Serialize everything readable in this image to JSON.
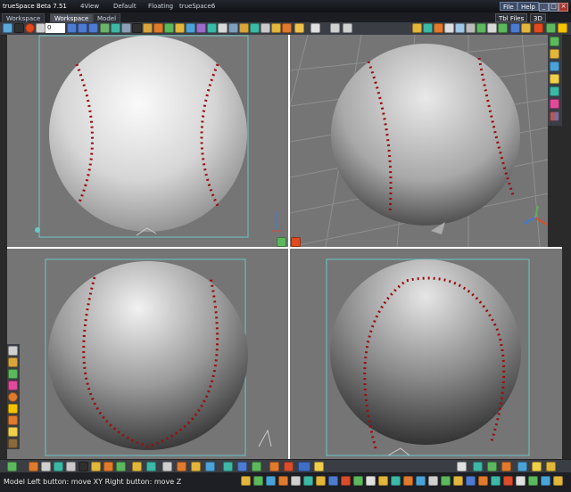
{
  "app": {
    "title": "trueSpace Beta 7.51",
    "menu": [
      "4View",
      "Default",
      "Floating",
      "trueSpace6"
    ],
    "window_buttons": [
      "File",
      "Help"
    ],
    "right_tab": "Tbl Files",
    "view_mode": "3D"
  },
  "tabs": [
    {
      "label": "Workspace",
      "active": false
    },
    {
      "label": "Workspace",
      "active": true
    },
    {
      "label": "Model",
      "active": false
    }
  ],
  "toolbar": {
    "frame_value": "0"
  },
  "status": {
    "text": "Model  Left button: move XY  Right button: move Z"
  },
  "colors": {
    "viewport_bg": "#757575",
    "seam": "#9a0f0f",
    "frame": "#6bc7c4",
    "divider": "#ffffff"
  },
  "icons": {
    "toolbar": [
      "workspace-icon",
      "stop-icon",
      "record-icon",
      "numeric-input",
      "play-reverse-icon",
      "rewind-icon",
      "play-icon",
      "forward-icon",
      "loop-icon",
      "anim-icon",
      "object-tool-icon",
      "camera-icon",
      "light-icon",
      "paint-icon",
      "select-icon",
      "move-icon",
      "rotate-icon",
      "scale-icon",
      "link-icon",
      "undo-icon",
      "redo-icon",
      "cut-icon",
      "copy-icon",
      "paste-icon",
      "primitive-icon",
      "sphere-icon",
      "cube-icon",
      "grid-icon",
      "render-icon",
      "snap-icon",
      "axis-icon",
      "xyz-icon"
    ],
    "right_strip": [
      "library-icon",
      "material-icon",
      "color-icon",
      "light-bulb-icon",
      "render-icon",
      "texture-icon",
      "palette-icon"
    ],
    "left_strip": [
      "object-icon",
      "brush-icon",
      "gear-icon",
      "triangle-icon",
      "sphere-icon",
      "sun-icon",
      "flower-icon",
      "bulb-icon",
      "hammer-icon"
    ],
    "bottom": [
      "node-icon",
      "sun-icon",
      "brush-icon",
      "pen-icon",
      "bucket-icon",
      "chain-icon",
      "disk-icon",
      "head-icon",
      "shield-icon",
      "wand-icon",
      "deform-icon",
      "vertex-icon",
      "edge-icon",
      "face-icon",
      "lathe-icon",
      "sweep-icon",
      "boolean-icon",
      "camera-icon",
      "clock-icon",
      "video-icon",
      "material-icon",
      "render-icon"
    ]
  }
}
